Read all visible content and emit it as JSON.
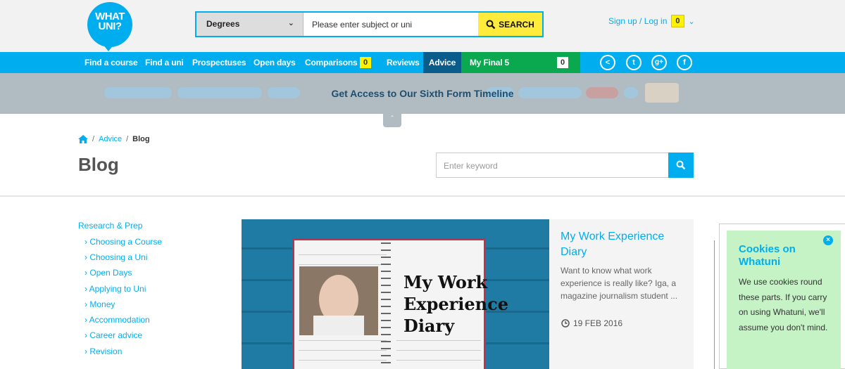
{
  "header": {
    "logo_line1": "WHAT",
    "logo_line2": "UNI?",
    "search": {
      "select_value": "Degrees",
      "query_placeholder": "Please enter subject or uni",
      "button_label": "SEARCH"
    },
    "signup_label": "Sign up / Log in",
    "signup_count": "0"
  },
  "nav": {
    "items": [
      {
        "label": "Find a course"
      },
      {
        "label": "Find a uni"
      },
      {
        "label": "Prospectuses"
      },
      {
        "label": "Open days"
      },
      {
        "label": "Comparisons",
        "count": "0"
      },
      {
        "label": "Reviews"
      },
      {
        "label": "Advice"
      },
      {
        "label": "My Final 5",
        "count": "0"
      }
    ],
    "social_icons": [
      "share-icon",
      "twitter-icon",
      "google-plus-icon",
      "facebook-icon"
    ]
  },
  "banner": {
    "text": "Get Access to Our Sixth Form Timeline"
  },
  "breadcrumb": {
    "items": [
      "Advice",
      "Blog"
    ]
  },
  "page_title": "Blog",
  "keyword_search": {
    "placeholder": "Enter keyword"
  },
  "sidebar": {
    "heading": "Research & Prep",
    "items": [
      "Choosing a Course",
      "Choosing a Uni",
      "Open Days",
      "Applying to Uni",
      "Money",
      "Accommodation",
      "Career advice",
      "Revision"
    ]
  },
  "article": {
    "image_text_lines": [
      "My Work",
      "Experience",
      "Diary"
    ],
    "title": "My Work Experience Diary",
    "description": "Want to know what work experience is really like? Iga, a magazine journalism student ...",
    "date": "19 FEB 2016"
  },
  "cookies": {
    "title": "Cookies on Whatuni",
    "text": "We use cookies round these parts. If you carry on using Whatuni, we'll assume you don't mind."
  },
  "colors": {
    "brand_blue": "#00aeef",
    "advice_nav": "#0a5c8a",
    "final5_nav": "#0aa84f",
    "badge_yellow": "#fff200",
    "cookie_bg": "#c5f3c5"
  }
}
